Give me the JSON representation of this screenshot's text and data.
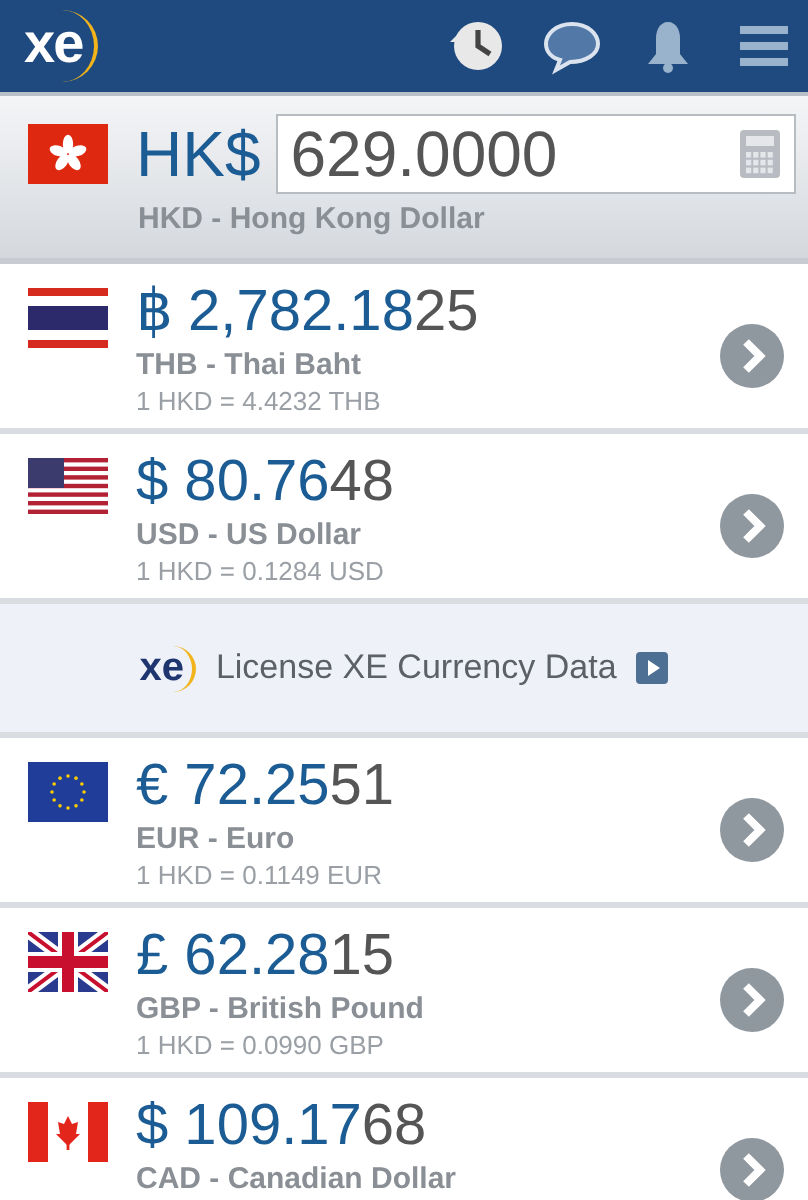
{
  "header": {
    "logo": "xe"
  },
  "base": {
    "symbol": "HK$",
    "amount": "629.0000",
    "name": "HKD - Hong Kong Dollar",
    "flag": {
      "kind": "hk"
    }
  },
  "rows": [
    {
      "kind": "currency",
      "flag": {
        "kind": "th"
      },
      "amount": "฿ 2,782.18",
      "amount_tail": "25",
      "name": "THB - Thai Baht",
      "rate": "1 HKD = 4.4232 THB"
    },
    {
      "kind": "currency",
      "flag": {
        "kind": "us"
      },
      "amount": "$ 80.76",
      "amount_tail": "48",
      "name": "USD - US Dollar",
      "rate": "1 HKD = 0.1284 USD"
    },
    {
      "kind": "banner",
      "logo": "xe",
      "text": "License XE Currency Data"
    },
    {
      "kind": "currency",
      "flag": {
        "kind": "eu"
      },
      "amount": "€ 72.25",
      "amount_tail": "51",
      "name": "EUR - Euro",
      "rate": "1 HKD = 0.1149 EUR"
    },
    {
      "kind": "currency",
      "flag": {
        "kind": "gb"
      },
      "amount": "£ 62.28",
      "amount_tail": "15",
      "name": "GBP - British Pound",
      "rate": "1 HKD = 0.0990 GBP"
    },
    {
      "kind": "currency",
      "flag": {
        "kind": "ca"
      },
      "amount": "$ 109.17",
      "amount_tail": "68",
      "name": "CAD - Canadian Dollar"
    }
  ]
}
